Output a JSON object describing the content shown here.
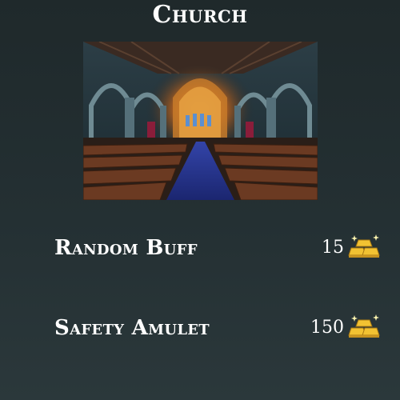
{
  "shop": {
    "title": "Church",
    "image": {
      "subject": "church-interior"
    },
    "items": [
      {
        "name": "Random Buff",
        "price": "15",
        "currency_icon": "gold-bars-icon"
      },
      {
        "name": "Safety Amulet",
        "price": "150",
        "currency_icon": "gold-bars-icon"
      }
    ]
  },
  "colors": {
    "background_top": "#1f292b",
    "background_bottom": "#2b383b",
    "text": "#ffffff",
    "gold": "#f2c232",
    "carpet": "#1f2d7a"
  }
}
